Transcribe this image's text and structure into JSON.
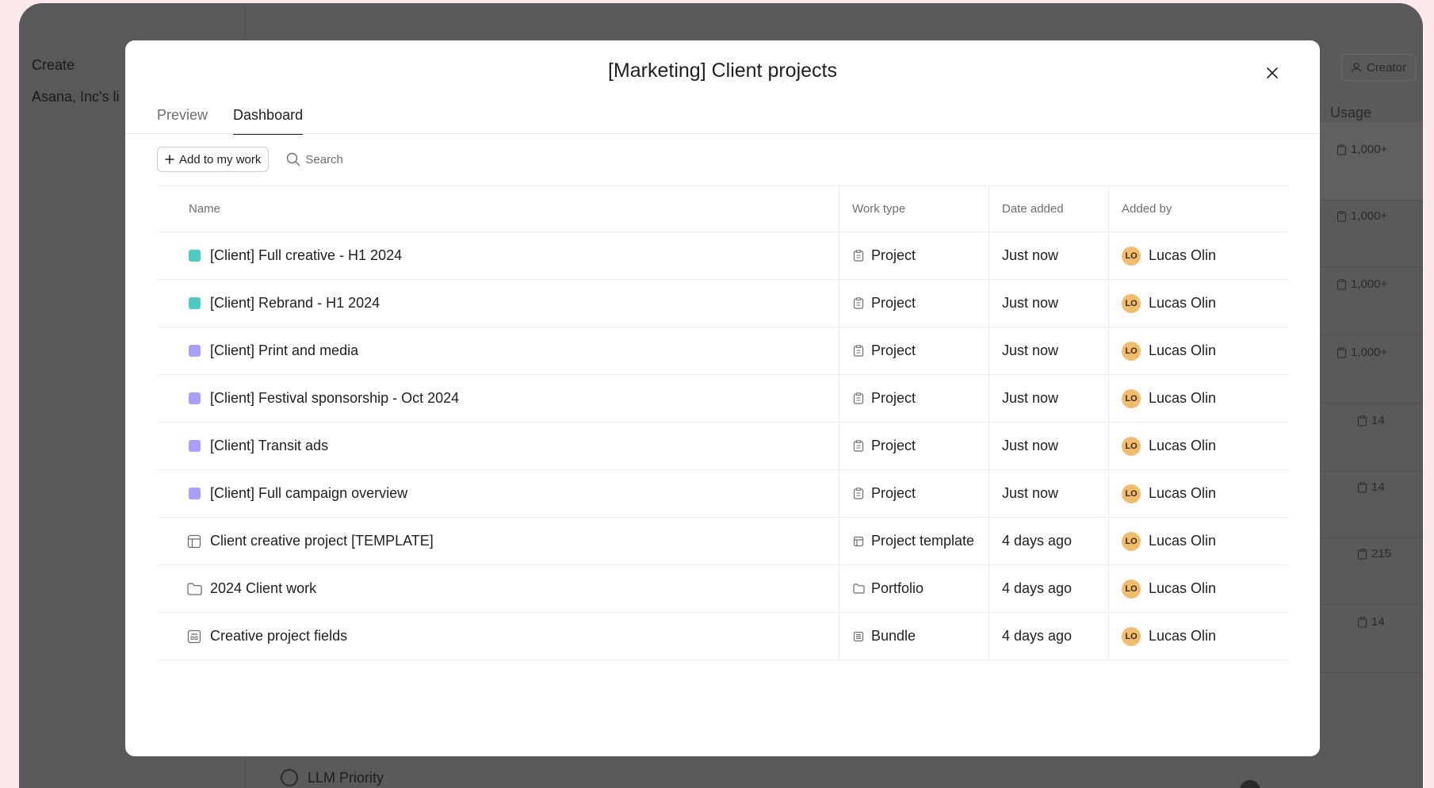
{
  "background": {
    "sidebar_lines": [
      "Create",
      "Asana, Inc's li"
    ],
    "creator_filter": "Creator",
    "usage_header": "Usage",
    "usage_values": [
      "1,000+",
      "1,000+",
      "1,000+",
      "1,000+",
      "14",
      "14",
      "215",
      "14"
    ],
    "bottom_item": "LLM Priority"
  },
  "modal": {
    "title": "[Marketing] Client projects",
    "tabs": [
      {
        "label": "Preview",
        "active": false
      },
      {
        "label": "Dashboard",
        "active": true
      }
    ],
    "toolbar": {
      "add_label": "Add to my work",
      "search_label": "Search"
    },
    "columns": [
      "Name",
      "Work type",
      "Date added",
      "Added by"
    ],
    "rows": [
      {
        "name": "[Client] Full creative - H1 2024",
        "swatch": "#4ecbc4",
        "work_type": "Project",
        "date": "Just now",
        "initials": "LO",
        "added_by": "Lucas Olin"
      },
      {
        "name": "[Client] Rebrand - H1 2024",
        "swatch": "#4ecbc4",
        "work_type": "Project",
        "date": "Just now",
        "initials": "LO",
        "added_by": "Lucas Olin"
      },
      {
        "name": "[Client] Print and media",
        "swatch": "#aa9ff8",
        "work_type": "Project",
        "date": "Just now",
        "initials": "LO",
        "added_by": "Lucas Olin"
      },
      {
        "name": "[Client] Festival sponsorship - Oct 2024",
        "swatch": "#aa9ff8",
        "work_type": "Project",
        "date": "Just now",
        "initials": "LO",
        "added_by": "Lucas Olin"
      },
      {
        "name": "[Client] Transit ads",
        "swatch": "#aa9ff8",
        "work_type": "Project",
        "date": "Just now",
        "initials": "LO",
        "added_by": "Lucas Olin"
      },
      {
        "name": "[Client] Full campaign overview",
        "swatch": "#aa9ff8",
        "work_type": "Project",
        "date": "Just now",
        "initials": "LO",
        "added_by": "Lucas Olin"
      },
      {
        "name": "Client creative project [TEMPLATE]",
        "icon": "template-icon",
        "work_type": "Project template",
        "date": "4 days ago",
        "initials": "LO",
        "added_by": "Lucas Olin"
      },
      {
        "name": "2024 Client work",
        "icon": "folder-icon",
        "work_type": "Portfolio",
        "date": "4 days ago",
        "initials": "LO",
        "added_by": "Lucas Olin"
      },
      {
        "name": "Creative project fields",
        "icon": "bundle-icon",
        "work_type": "Bundle",
        "date": "4 days ago",
        "initials": "LO",
        "added_by": "Lucas Olin"
      }
    ]
  }
}
